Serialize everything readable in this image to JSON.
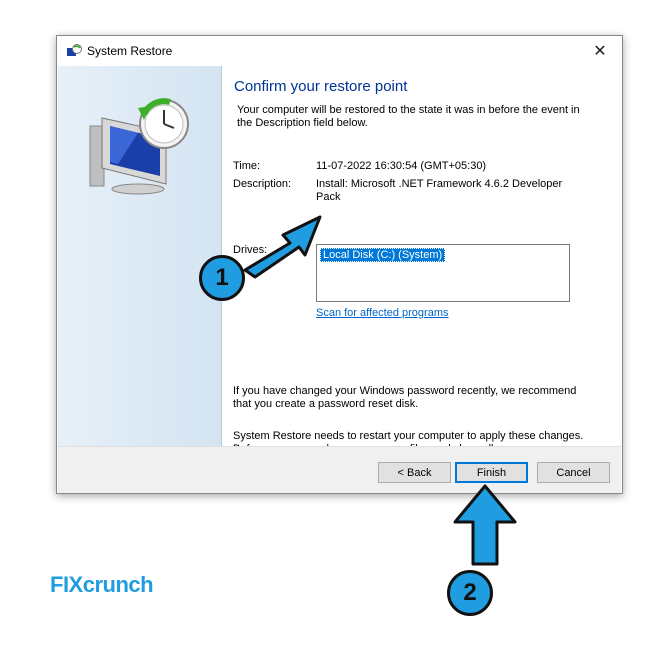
{
  "window": {
    "title": "System Restore",
    "close_glyph": "✕"
  },
  "content": {
    "heading": "Confirm your restore point",
    "intro": "Your computer will be restored to the state it was in before the event in the Description field below.",
    "time_label": "Time:",
    "time_value": "11-07-2022 16:30:54 (GMT+05:30)",
    "description_label": "Description:",
    "description_value": "Install: Microsoft .NET Framework 4.6.2 Developer Pack",
    "drives_label": "Drives:",
    "drives": [
      "Local Disk (C:) (System)"
    ],
    "scan_link": "Scan for affected programs",
    "note_password": "If you have changed your Windows password recently, we recommend that you create a password reset disk.",
    "note_restart": "System Restore needs to restart your computer to apply these changes. Before you proceed, save any open files and close all programs."
  },
  "buttons": {
    "back": "< Back",
    "finish": "Finish",
    "cancel": "Cancel"
  },
  "callouts": {
    "first": "1",
    "second": "2"
  },
  "brand": "FIXcrunch",
  "colors": {
    "accent": "#1f9de0",
    "selection": "#0078d7",
    "heading": "#003399",
    "link": "#0066cc"
  },
  "icons": [
    "system-restore-icon",
    "close-icon",
    "arrow-pointer-icon"
  ]
}
